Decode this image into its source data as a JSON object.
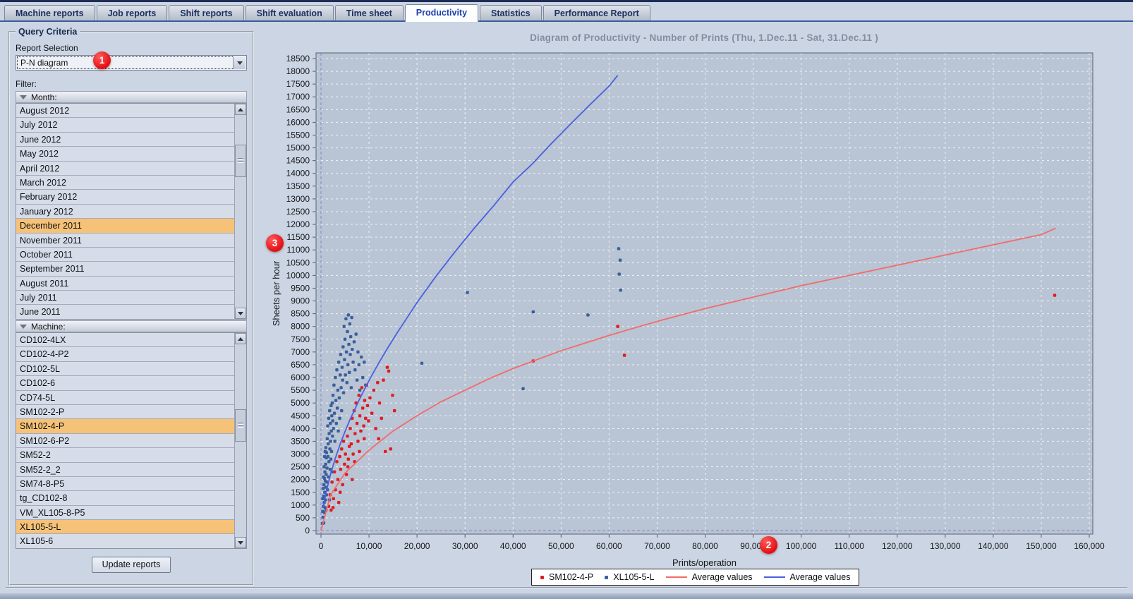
{
  "tabs": [
    {
      "label": "Machine reports"
    },
    {
      "label": "Job reports"
    },
    {
      "label": "Shift reports"
    },
    {
      "label": "Shift evaluation"
    },
    {
      "label": "Time sheet"
    },
    {
      "label": "Productivity"
    },
    {
      "label": "Statistics"
    },
    {
      "label": "Performance Report"
    }
  ],
  "sidebar": {
    "group_title": "Query Criteria",
    "report_selection_label": "Report Selection",
    "report_selection_value": "P-N diagram",
    "filter_label": "Filter:",
    "month_header": "Month:",
    "months": [
      "August 2012",
      "July 2012",
      "June 2012",
      "May 2012",
      "April 2012",
      "March 2012",
      "February 2012",
      "January 2012",
      "December 2011",
      "November 2011",
      "October 2011",
      "September 2011",
      "August 2011",
      "July 2011",
      "June 2011"
    ],
    "selected_months": [
      "December 2011"
    ],
    "machine_header": "Machine:",
    "machines": [
      "CD102-4LX",
      "CD102-4-P2",
      "CD102-5L",
      "CD102-6",
      "CD74-5L",
      "SM102-2-P",
      "SM102-4-P",
      "SM102-6-P2",
      "SM52-2",
      "SM52-2_2",
      "SM74-8-P5",
      "tg_CD102-8",
      "VM_XL105-8-P5",
      "XL105-5-L",
      "XL105-6"
    ],
    "selected_machines": [
      "SM102-4-P",
      "XL105-5-L"
    ],
    "update_button": "Update reports"
  },
  "annotations": {
    "n1": "1",
    "n2": "2",
    "n3": "3"
  },
  "chart_data": {
    "type": "scatter",
    "title": "Diagram of Productivity - Number of Prints   (Thu, 1.Dec.11  - Sat, 31.Dec.11 )",
    "xlabel": "Prints/operation",
    "ylabel": "Sheets per hour",
    "xlim": [
      0,
      160000
    ],
    "ylim": [
      0,
      18500
    ],
    "xstep": 10000,
    "ystep": 500,
    "grid": true,
    "legend_position": "bottom",
    "plot_bg": "#b9c4d4",
    "grid_color": "#ffffff",
    "zero_line_color": "#8585cc",
    "series": [
      {
        "name": "SM102-4-P",
        "kind": "scatter",
        "color": "#e11b1e",
        "points": [
          [
            1600,
            950
          ],
          [
            1900,
            1400
          ],
          [
            2100,
            800
          ],
          [
            2300,
            1900
          ],
          [
            2500,
            900
          ],
          [
            2600,
            1250
          ],
          [
            2800,
            2300
          ],
          [
            3000,
            1600
          ],
          [
            3300,
            2700
          ],
          [
            3500,
            2000
          ],
          [
            3700,
            1100
          ],
          [
            3900,
            2900
          ],
          [
            4000,
            1500
          ],
          [
            4100,
            2400
          ],
          [
            4300,
            3200
          ],
          [
            4500,
            1800
          ],
          [
            4700,
            3500
          ],
          [
            4900,
            2600
          ],
          [
            5100,
            3000
          ],
          [
            5300,
            2200
          ],
          [
            5500,
            3700
          ],
          [
            5600,
            2500
          ],
          [
            5700,
            2800
          ],
          [
            5900,
            3300
          ],
          [
            6100,
            4000
          ],
          [
            6300,
            3400
          ],
          [
            6500,
            4400
          ],
          [
            6500,
            2000
          ],
          [
            6700,
            3000
          ],
          [
            6900,
            4700
          ],
          [
            7000,
            2700
          ],
          [
            7100,
            3800
          ],
          [
            7300,
            5000
          ],
          [
            7500,
            4200
          ],
          [
            7700,
            3500
          ],
          [
            7900,
            5300
          ],
          [
            8000,
            3100
          ],
          [
            8100,
            4500
          ],
          [
            8300,
            3900
          ],
          [
            8500,
            5600
          ],
          [
            8700,
            4800
          ],
          [
            8900,
            4100
          ],
          [
            9000,
            3600
          ],
          [
            9100,
            5100
          ],
          [
            9300,
            4400
          ],
          [
            9500,
            5700
          ],
          [
            9700,
            4900
          ],
          [
            9900,
            4300
          ],
          [
            10200,
            5200
          ],
          [
            10600,
            4600
          ],
          [
            11000,
            5500
          ],
          [
            11400,
            4000
          ],
          [
            11800,
            5800
          ],
          [
            12000,
            3600
          ],
          [
            12200,
            5000
          ],
          [
            12600,
            4400
          ],
          [
            13000,
            5900
          ],
          [
            13400,
            3100
          ],
          [
            13800,
            6400
          ],
          [
            14100,
            6250
          ],
          [
            14500,
            3200
          ],
          [
            14900,
            5300
          ],
          [
            15300,
            4700
          ],
          [
            44200,
            6650
          ],
          [
            61800,
            8000
          ],
          [
            63200,
            6870
          ],
          [
            152800,
            9220
          ]
        ]
      },
      {
        "name": "XL105-5-L",
        "kind": "scatter",
        "color": "#3a5f9d",
        "points": [
          [
            320,
            280
          ],
          [
            350,
            750
          ],
          [
            380,
            1250
          ],
          [
            420,
            520
          ],
          [
            450,
            1650
          ],
          [
            480,
            950
          ],
          [
            510,
            2100
          ],
          [
            540,
            1350
          ],
          [
            570,
            300
          ],
          [
            600,
            1800
          ],
          [
            630,
            2500
          ],
          [
            660,
            1100
          ],
          [
            690,
            2050
          ],
          [
            720,
            700
          ],
          [
            750,
            2900
          ],
          [
            780,
            1500
          ],
          [
            810,
            2300
          ],
          [
            840,
            900
          ],
          [
            870,
            3100
          ],
          [
            900,
            1950
          ],
          [
            930,
            1200
          ],
          [
            960,
            2600
          ],
          [
            990,
            1700
          ],
          [
            1020,
            3250
          ],
          [
            1050,
            800
          ],
          [
            1080,
            2200
          ],
          [
            1110,
            2850
          ],
          [
            1140,
            1400
          ],
          [
            1170,
            3050
          ],
          [
            1200,
            1900
          ],
          [
            1250,
            2450
          ],
          [
            1300,
            3600
          ],
          [
            1350,
            1600
          ],
          [
            1400,
            4100
          ],
          [
            1450,
            2900
          ],
          [
            1500,
            3400
          ],
          [
            1550,
            2100
          ],
          [
            1600,
            4400
          ],
          [
            1650,
            2700
          ],
          [
            1700,
            3800
          ],
          [
            1750,
            1200
          ],
          [
            1800,
            4700
          ],
          [
            1850,
            3200
          ],
          [
            1900,
            2400
          ],
          [
            1950,
            4200
          ],
          [
            2000,
            3500
          ],
          [
            2050,
            2800
          ],
          [
            2100,
            4900
          ],
          [
            2150,
            3900
          ],
          [
            2200,
            3100
          ],
          [
            2250,
            4500
          ],
          [
            2300,
            2300
          ],
          [
            2350,
            5000
          ],
          [
            2400,
            3700
          ],
          [
            2450,
            4300
          ],
          [
            2500,
            5300
          ],
          [
            2600,
            4000
          ],
          [
            2700,
            5700
          ],
          [
            2800,
            4600
          ],
          [
            2900,
            3500
          ],
          [
            3000,
            6000
          ],
          [
            3100,
            5100
          ],
          [
            3200,
            4200
          ],
          [
            3300,
            6300
          ],
          [
            3400,
            4800
          ],
          [
            3500,
            5500
          ],
          [
            3600,
            3900
          ],
          [
            3700,
            6600
          ],
          [
            3800,
            5200
          ],
          [
            3900,
            4400
          ],
          [
            4000,
            6100
          ],
          [
            4100,
            6900
          ],
          [
            4200,
            5600
          ],
          [
            4300,
            4700
          ],
          [
            4400,
            6400
          ],
          [
            4500,
            5900
          ],
          [
            4600,
            7200
          ],
          [
            4700,
            5400
          ],
          [
            4800,
            8000
          ],
          [
            4900,
            6700
          ],
          [
            5000,
            7500
          ],
          [
            5100,
            6100
          ],
          [
            5200,
            8300
          ],
          [
            5300,
            7000
          ],
          [
            5400,
            5800
          ],
          [
            5500,
            7800
          ],
          [
            5600,
            6500
          ],
          [
            5700,
            8450
          ],
          [
            5800,
            7300
          ],
          [
            5900,
            6200
          ],
          [
            6000,
            8100
          ],
          [
            6100,
            6900
          ],
          [
            6200,
            7600
          ],
          [
            6300,
            5600
          ],
          [
            6400,
            8350
          ],
          [
            6500,
            7100
          ],
          [
            6700,
            6600
          ],
          [
            6900,
            7400
          ],
          [
            7100,
            6300
          ],
          [
            7300,
            7700
          ],
          [
            7500,
            5900
          ],
          [
            7700,
            7000
          ],
          [
            7900,
            6500
          ],
          [
            8100,
            5500
          ],
          [
            8400,
            6800
          ],
          [
            8700,
            6000
          ],
          [
            9000,
            6600
          ],
          [
            9300,
            5700
          ],
          [
            21000,
            6560
          ],
          [
            30500,
            9330
          ],
          [
            42100,
            5560
          ],
          [
            44200,
            8570
          ],
          [
            55600,
            8450
          ],
          [
            62000,
            11050
          ],
          [
            62300,
            10600
          ],
          [
            62100,
            10050
          ],
          [
            62400,
            9420
          ]
        ]
      },
      {
        "name": "Average values",
        "kind": "line",
        "color": "#f26b6b",
        "points": [
          [
            0,
            0
          ],
          [
            2000,
            1400
          ],
          [
            5000,
            2250
          ],
          [
            10000,
            3150
          ],
          [
            15000,
            3900
          ],
          [
            20000,
            4500
          ],
          [
            25000,
            5050
          ],
          [
            30000,
            5500
          ],
          [
            35000,
            5950
          ],
          [
            40000,
            6350
          ],
          [
            45000,
            6700
          ],
          [
            50000,
            7050
          ],
          [
            55000,
            7350
          ],
          [
            60000,
            7650
          ],
          [
            70000,
            8200
          ],
          [
            80000,
            8700
          ],
          [
            90000,
            9150
          ],
          [
            100000,
            9600
          ],
          [
            110000,
            10000
          ],
          [
            120000,
            10400
          ],
          [
            130000,
            10800
          ],
          [
            140000,
            11200
          ],
          [
            150000,
            11600
          ],
          [
            153000,
            11850
          ]
        ]
      },
      {
        "name": "Average values",
        "kind": "line",
        "color": "#4b5fe0",
        "points": [
          [
            500,
            950
          ],
          [
            1000,
            1450
          ],
          [
            2000,
            2220
          ],
          [
            3000,
            2840
          ],
          [
            4000,
            3390
          ],
          [
            5000,
            3880
          ],
          [
            6000,
            4330
          ],
          [
            8000,
            5140
          ],
          [
            10000,
            5880
          ],
          [
            12000,
            6560
          ],
          [
            14000,
            7190
          ],
          [
            16000,
            7790
          ],
          [
            18000,
            8360
          ],
          [
            20000,
            8940
          ],
          [
            24000,
            9980
          ],
          [
            28000,
            10950
          ],
          [
            32000,
            11870
          ],
          [
            36000,
            12740
          ],
          [
            40000,
            13660
          ],
          [
            44000,
            14370
          ],
          [
            48000,
            15170
          ],
          [
            52000,
            15940
          ],
          [
            56000,
            16690
          ],
          [
            60000,
            17420
          ],
          [
            61800,
            17840
          ]
        ]
      }
    ]
  }
}
